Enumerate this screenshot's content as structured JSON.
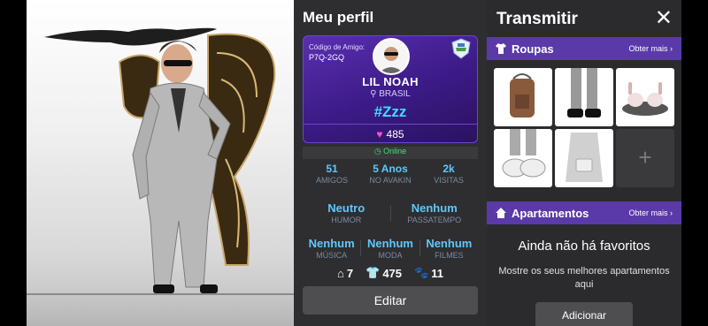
{
  "profile": {
    "title": "Meu perfil",
    "friend_code_label": "Código de Amigo:",
    "friend_code": "P7Q-2GQ",
    "name": "LIL NOAH",
    "country": "BRASIL",
    "status": "#Zzz",
    "hearts": "485",
    "online": "Online",
    "stats": [
      {
        "value": "51",
        "label": "AMIGOS"
      },
      {
        "value": "5 Anos",
        "label": "NO AVAKIN"
      },
      {
        "value": "2k",
        "label": "VISITAS"
      }
    ],
    "mood": {
      "value": "Neutro",
      "label": "HUMOR"
    },
    "hobby": {
      "value": "Nenhum",
      "label": "PASSATEMPO"
    },
    "prefs": [
      {
        "value": "Nenhum",
        "label": "MÚSICA"
      },
      {
        "value": "Nenhum",
        "label": "MODA"
      },
      {
        "value": "Nenhum",
        "label": "FILMES"
      }
    ],
    "counts": {
      "homes": "7",
      "outfits": "475",
      "pets": "11"
    },
    "edit_label": "Editar"
  },
  "broadcast": {
    "title": "Transmitir",
    "close_icon": "close-icon",
    "clothes": {
      "title": "Roupas",
      "more": "Obter mais ›"
    },
    "apartments": {
      "title": "Apartamentos",
      "more": "Obter mais ›"
    },
    "no_favorites": "Ainda não há favoritos",
    "no_favorites_sub": "Mostre os seus melhores apartamentos aqui",
    "add_label": "Adicionar",
    "add_tile": "+"
  },
  "colors": {
    "accent": "#5a3aa8",
    "stat": "#5ec8ff",
    "online": "#3fe07a",
    "heart": "#ff4fd6"
  }
}
